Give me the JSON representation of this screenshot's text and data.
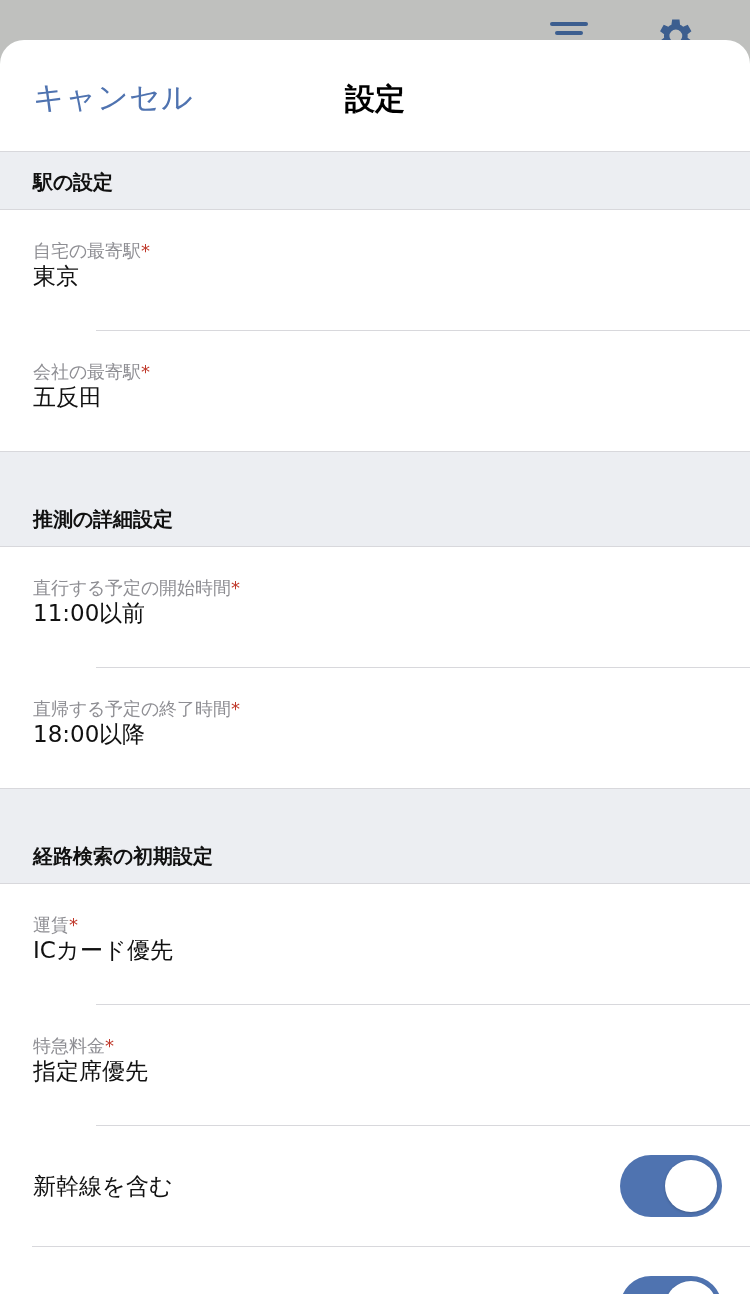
{
  "header": {
    "cancel": "キャンセル",
    "title": "設定"
  },
  "sections": [
    {
      "title": "駅の設定",
      "rows": [
        {
          "kind": "field",
          "label": "自宅の最寄駅",
          "asterisk": "*",
          "value": "東京"
        },
        {
          "kind": "field",
          "label": "会社の最寄駅",
          "asterisk": "*",
          "value": "五反田"
        }
      ]
    },
    {
      "title": "推測の詳細設定",
      "rows": [
        {
          "kind": "field",
          "label": "直行する予定の開始時間",
          "asterisk": "*",
          "value": "11:00以前"
        },
        {
          "kind": "field",
          "label": "直帰する予定の終了時間",
          "asterisk": "*",
          "value": "18:00以降"
        }
      ]
    },
    {
      "title": "経路検索の初期設定",
      "rows": [
        {
          "kind": "field",
          "label": "運賃",
          "asterisk": "*",
          "value": "ICカード優先"
        },
        {
          "kind": "field",
          "label": "特急料金",
          "asterisk": "*",
          "value": "指定席優先"
        },
        {
          "kind": "toggle",
          "label": "新幹線を含む",
          "on": true
        },
        {
          "kind": "toggle",
          "on": true
        }
      ]
    }
  ]
}
